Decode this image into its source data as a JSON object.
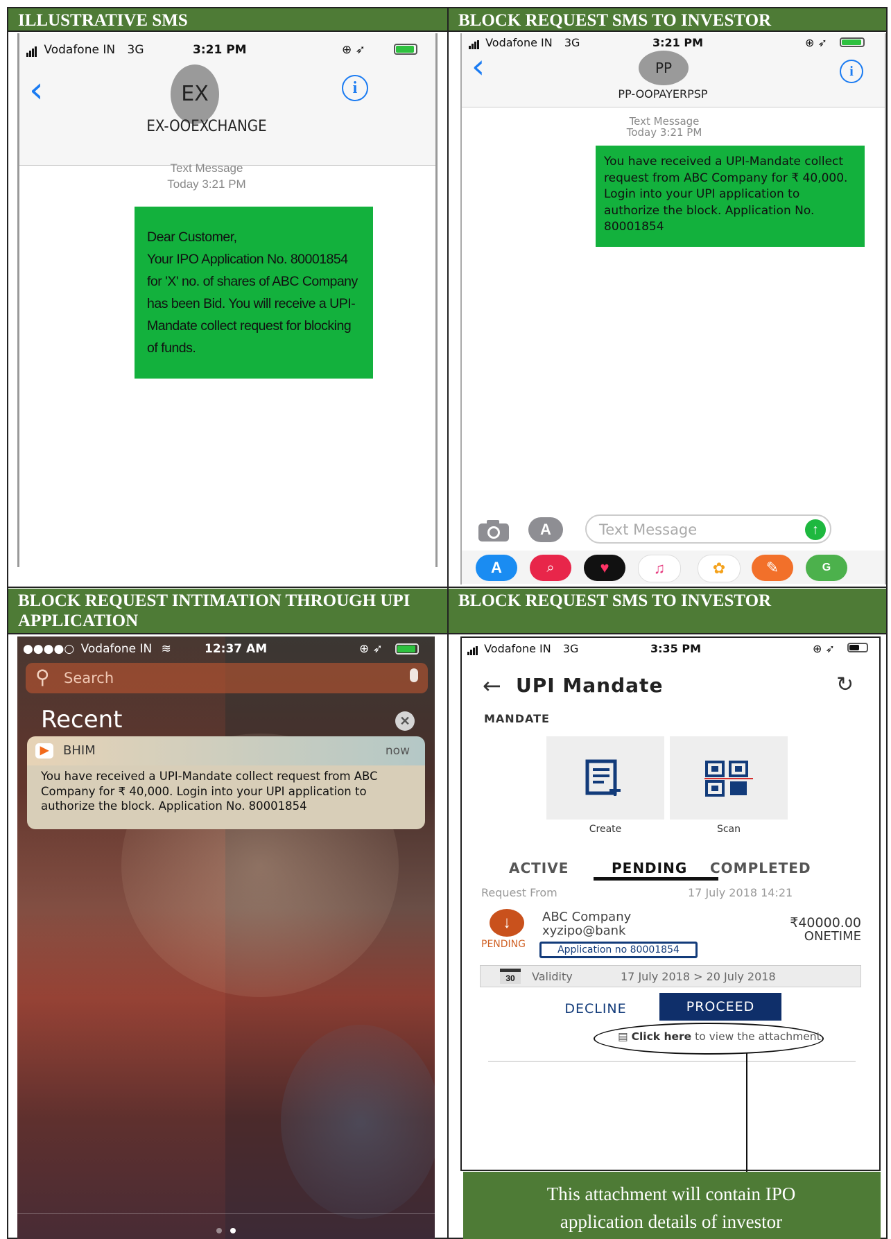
{
  "headers": {
    "q1": "ILLUSTRATIVE SMS",
    "q2": "BLOCK REQUEST SMS TO INVESTOR",
    "q3": "BLOCK REQUEST INTIMATION THROUGH UPI APPLICATION",
    "q4": "BLOCK REQUEST SMS TO INVESTOR"
  },
  "sms1": {
    "carrier": "Vodafone IN",
    "network": "3G",
    "time": "3:21 PM",
    "avatar": "EX",
    "sender": "EX-OOEXCHANGE",
    "meta_type": "Text Message",
    "meta_time": "Today 3:21 PM",
    "message": "Dear Customer,\nYour IPO Application No. 80001854 for 'X' no. of shares of ABC Company has been Bid. You will receive a UPI-Mandate collect request for blocking of funds.",
    "bubble_color": "#13b13d"
  },
  "sms2": {
    "carrier": "Vodafone IN",
    "network": "3G",
    "time": "3:21 PM",
    "avatar": "PP",
    "sender": "PP-OOPAYERPSP",
    "meta_type": "Text Message",
    "meta_time": "Today 3:21 PM",
    "message": "You have received a UPI-Mandate collect request from ABC Company for ₹ 40,000. Login into your UPI application to authorize the block. Application No. 80001854",
    "input_placeholder": "Text Message",
    "app_icons": [
      "app-store-icon",
      "search-images-icon",
      "heart-icon",
      "music-icon",
      "photos-icon",
      "guitar-icon",
      "maps-icon"
    ]
  },
  "notif": {
    "carrier": "Vodafone IN",
    "time": "12:37 AM",
    "search_placeholder": "Search",
    "recent": "Recent",
    "app": "BHIM",
    "when": "now",
    "message": "You have received a UPI-Mandate collect request from ABC Company for ₹ 40,000. Login into your UPI application to authorize the block. Application No. 80001854"
  },
  "upi": {
    "carrier": "Vodafone IN",
    "network": "3G",
    "time": "3:35 PM",
    "title": "UPI Mandate",
    "section": "MANDATE",
    "create": "Create",
    "scan": "Scan",
    "tabs": [
      "ACTIVE",
      "PENDING",
      "COMPLETED"
    ],
    "request_from": "Request From",
    "request_date": "17 July 2018 14:21",
    "company": "ABC Company",
    "vpa": "xyzipo@bank",
    "amount": "₹40000.00",
    "frequency": "ONETIME",
    "status": "PENDING",
    "application": "Application no 80001854",
    "calendar_day": "30",
    "validity_label": "Validity",
    "validity_range": "17 July 2018 > 20 July 2018",
    "decline": "DECLINE",
    "proceed": "PROCEED",
    "click_here": "Click here",
    "attachment_text": "to view the attachment",
    "callout": "This attachment will contain IPO application details of investor"
  }
}
